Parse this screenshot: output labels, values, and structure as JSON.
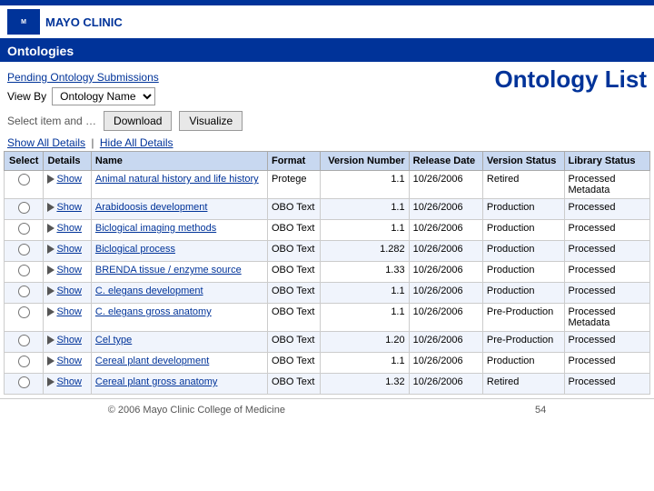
{
  "header": {
    "logo_text": "MAYO CLINIC",
    "app_title": "Ontologies",
    "page_title": "Ontology List"
  },
  "nav": {
    "pending_link": "Pending Ontology Submissions",
    "view_by_label": "View By",
    "view_by_value": "Ontology Name"
  },
  "toolbar": {
    "select_label": "Select item and …",
    "download_label": "Download",
    "visualize_label": "Visualize"
  },
  "details": {
    "show_all": "Show All Details",
    "separator": "|",
    "hide_all": "Hide All Details"
  },
  "table": {
    "columns": [
      "Select",
      "Details",
      "Name",
      "Format",
      "Version Number",
      "Release Date",
      "Version Status",
      "Library Status"
    ],
    "rows": [
      {
        "name": "Animal natural history and life history",
        "format": "Protege",
        "version": "1.1",
        "release_date": "10/26/2006",
        "version_status": "Retired",
        "library_status": "Processed Metadata"
      },
      {
        "name": "Arabidoosis development",
        "format": "OBO Text",
        "version": "1.1",
        "release_date": "10/26/2006",
        "version_status": "Production",
        "library_status": "Processed"
      },
      {
        "name": "Biclogical imaging methods",
        "format": "OBO Text",
        "version": "1.1",
        "release_date": "10/26/2006",
        "version_status": "Production",
        "library_status": "Processed"
      },
      {
        "name": "Biclogical process",
        "format": "OBO Text",
        "version": "1.282",
        "release_date": "10/26/2006",
        "version_status": "Production",
        "library_status": "Processed"
      },
      {
        "name": "BRENDA tissue / enzyme source",
        "format": "OBO Text",
        "version": "1.33",
        "release_date": "10/26/2006",
        "version_status": "Production",
        "library_status": "Processed"
      },
      {
        "name": "C. elegans development",
        "format": "OBO Text",
        "version": "1.1",
        "release_date": "10/26/2006",
        "version_status": "Production",
        "library_status": "Processed"
      },
      {
        "name": "C. elegans gross anatomy",
        "format": "OBO Text",
        "version": "1.1",
        "release_date": "10/26/2006",
        "version_status": "Pre-Production",
        "library_status": "Processed Metadata"
      },
      {
        "name": "Cel type",
        "format": "OBO Text",
        "version": "1.20",
        "release_date": "10/26/2006",
        "version_status": "Pre-Production",
        "library_status": "Processed"
      },
      {
        "name": "Cereal plant development",
        "format": "OBO Text",
        "version": "1.1",
        "release_date": "10/26/2006",
        "version_status": "Production",
        "library_status": "Processed"
      },
      {
        "name": "Cereal plant gross anatomy",
        "format": "OBO Text",
        "version": "1.32",
        "release_date": "10/26/2006",
        "version_status": "Retired",
        "library_status": "Processed"
      }
    ]
  },
  "footer": {
    "text": "© 2006 Mayo Clinic College of Medicine",
    "page_num": "54"
  }
}
